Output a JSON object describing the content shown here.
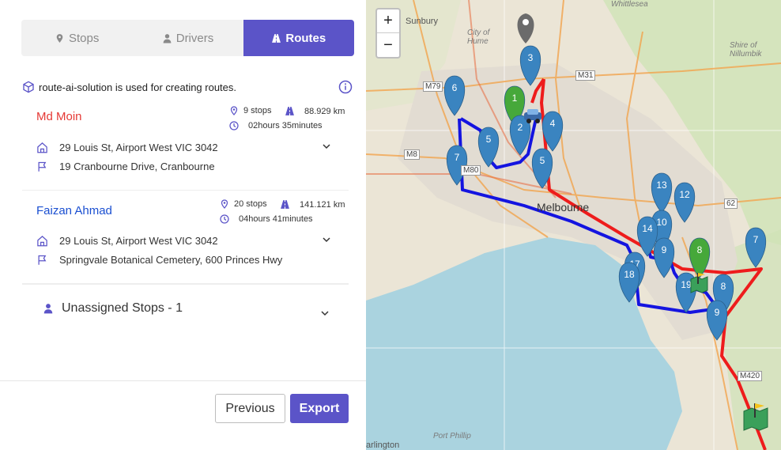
{
  "tabs": [
    {
      "label": "Stops",
      "icon": "map-pin-icon",
      "active": false
    },
    {
      "label": "Drivers",
      "icon": "user-icon",
      "active": false
    },
    {
      "label": "Routes",
      "icon": "road-icon",
      "active": true
    }
  ],
  "info": {
    "text": "route-ai-solution is used for creating routes."
  },
  "routes": [
    {
      "driver": "Md Moin",
      "driver_color": "#e53935",
      "stops": "9 stops",
      "distance": "88.929 km",
      "duration": "02hours 35minutes",
      "start": "29 Louis St, Airport West VIC 3042",
      "end": "19 Cranbourne Drive, Cranbourne"
    },
    {
      "driver": "Faizan Ahmad",
      "driver_color": "#1a4fd1",
      "stops": "20 stops",
      "distance": "141.121 km",
      "duration": "04hours 41minutes",
      "start": "29 Louis St, Airport West VIC 3042",
      "end": "Springvale Botanical Cemetery, 600 Princes Hwy"
    }
  ],
  "unassigned": {
    "label": "Unassigned Stops - 1"
  },
  "buttons": {
    "previous": "Previous",
    "export": "Export"
  },
  "map": {
    "zoom_in": "+",
    "zoom_out": "−",
    "labels": {
      "sunbury": "Sunbury",
      "whittlesea": "Whittlesea",
      "city_of_hume": "City of\nHume",
      "shire": "Shire of\nNillumbik",
      "melbourne": "Melbourne",
      "port_phillip": "Port Phillip",
      "darlington": "arlington",
      "m79": "M79",
      "m8": "M8",
      "m80": "M80",
      "m31": "M31",
      "r62": "62",
      "m420": "M420"
    },
    "markers": [
      {
        "label": "3",
        "color": "#3a84c0"
      },
      {
        "label": "1",
        "color": "#46a83a"
      },
      {
        "label": "6",
        "color": "#3a84c0"
      },
      {
        "label": "2",
        "color": "#3a84c0"
      },
      {
        "label": "4",
        "color": "#3a84c0"
      },
      {
        "label": "5",
        "color": "#3a84c0"
      },
      {
        "label": "7",
        "color": "#3a84c0"
      },
      {
        "label": "5",
        "color": "#3a84c0"
      },
      {
        "label": "13",
        "color": "#3a84c0"
      },
      {
        "label": "12",
        "color": "#3a84c0"
      },
      {
        "label": "10",
        "color": "#3a84c0"
      },
      {
        "label": "14",
        "color": "#3a84c0"
      },
      {
        "label": "9",
        "color": "#3a84c0"
      },
      {
        "label": "8",
        "color": "#46a83a"
      },
      {
        "label": "7",
        "color": "#3a84c0"
      },
      {
        "label": "17",
        "color": "#3a84c0"
      },
      {
        "label": "18",
        "color": "#3a84c0"
      },
      {
        "label": "19",
        "color": "#3a84c0"
      },
      {
        "label": "8",
        "color": "#3a84c0"
      },
      {
        "label": "9",
        "color": "#3a84c0"
      }
    ]
  },
  "colors": {
    "accent": "#5b54c8",
    "route_red": "#ee1c1c",
    "route_blue": "#1414e0"
  }
}
